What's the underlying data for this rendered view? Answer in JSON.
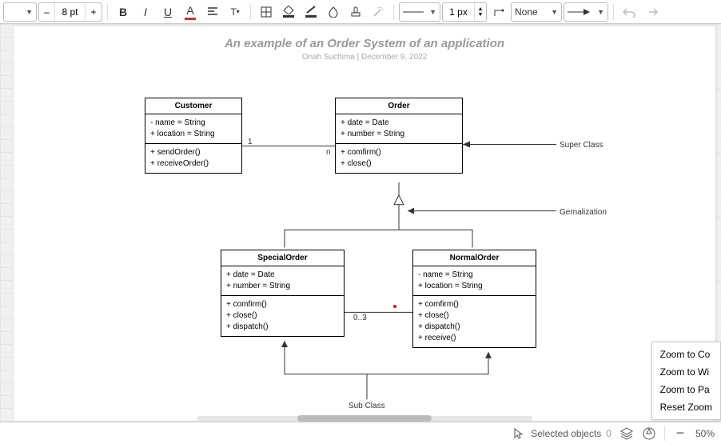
{
  "toolbar": {
    "zoom_select_arrow": "▼",
    "font_minus": "–",
    "font_size": "8 pt",
    "font_plus": "+",
    "bold": "B",
    "italic": "I",
    "underline": "U",
    "fontcolor_letter": "A",
    "line_width": "1 px",
    "line_style": "None",
    "none_arrow": "▼"
  },
  "page": {
    "title": "An example of an Order System of an application",
    "author": "Onah Suchima",
    "sep": "  |  ",
    "date": "December 9, 2022"
  },
  "labels": {
    "mult_one": "1",
    "mult_n": "n",
    "mult_03": "0..3",
    "super_class": "Super Class",
    "generalization": "Gernalization",
    "sub_class": "Sub Class"
  },
  "classes": {
    "customer": {
      "name": "Customer",
      "attrs": "- name = String\n+ location = String",
      "ops": "+ sendOrder()\n+ receiveOrder()"
    },
    "order": {
      "name": "Order",
      "attrs": "+ date = Date\n+ number = String",
      "ops": "+ comfirm()\n+ close()"
    },
    "special": {
      "name": "SpecialOrder",
      "attrs": "+ date = Date\n+ number = String",
      "ops": "+ comfirm()\n+ close()\n+ dispatch()"
    },
    "normal": {
      "name": "NormalOrder",
      "attrs": "- name = String\n+ location = String",
      "ops": "+ comfirm()\n+ close()\n+ dispatch()\n+ receive()"
    }
  },
  "status": {
    "selected_label": "Selected objects",
    "selected_count": "0",
    "zoom_value": "50%"
  },
  "zoom_menu": {
    "i0": "Zoom to Co",
    "i1": "Zoom to Wi",
    "i2": "Zoom to Pa",
    "i3": "Reset Zoom"
  }
}
